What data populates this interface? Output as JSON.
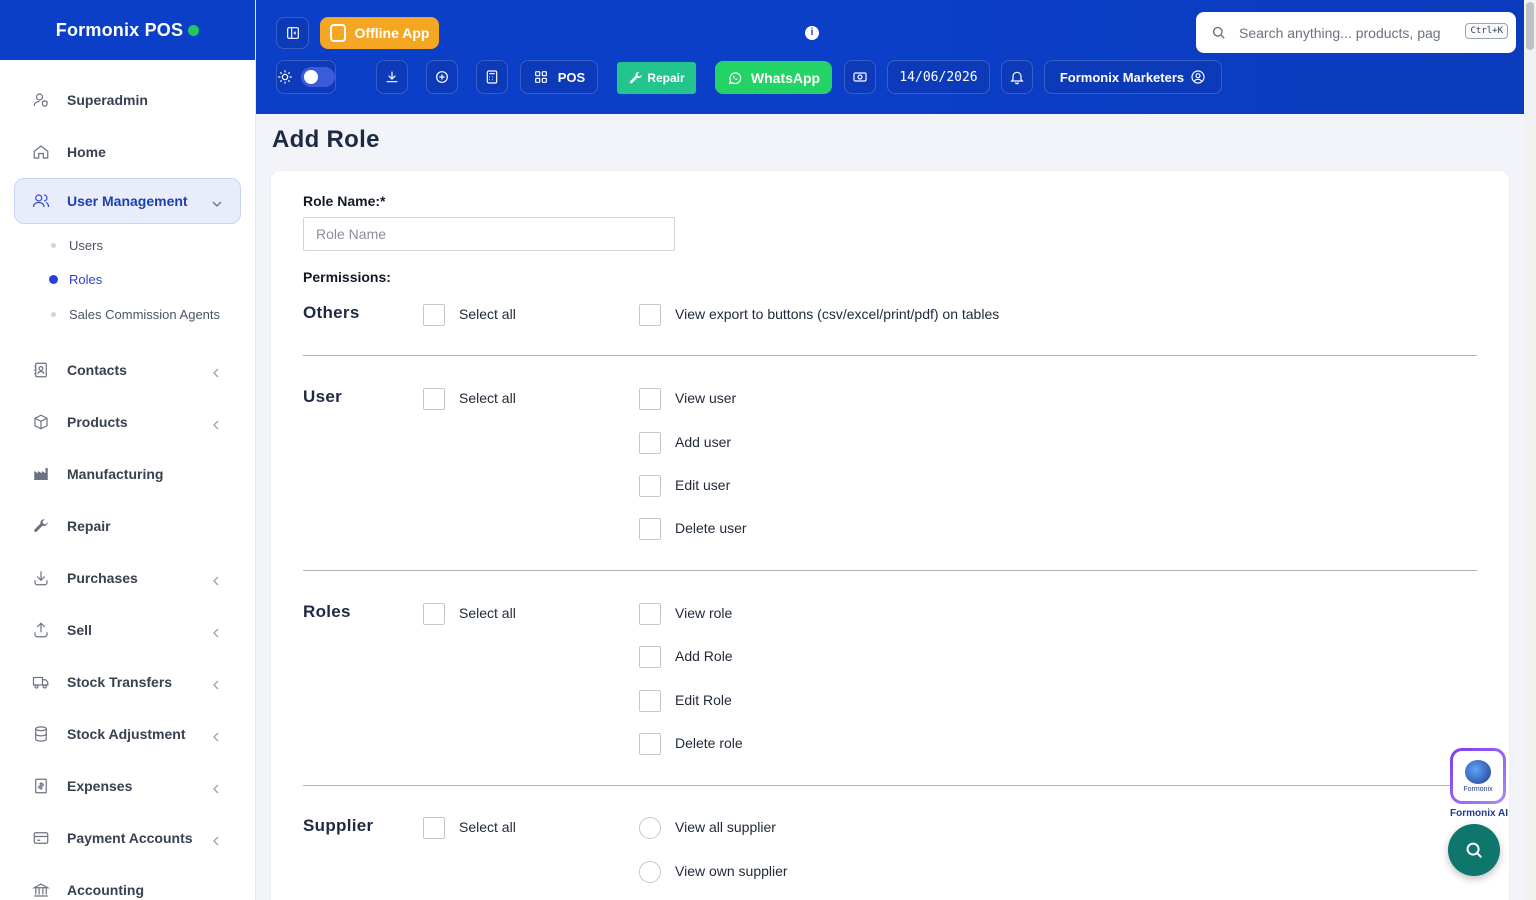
{
  "app": {
    "title": "Formonix POS"
  },
  "sidebar": {
    "items": [
      {
        "label": "Superadmin",
        "icon": "user-shield-icon",
        "chevron": false
      },
      {
        "label": "Home",
        "icon": "home-icon",
        "chevron": false
      },
      {
        "label": "User Management",
        "icon": "users-icon",
        "active": true,
        "expanded": true,
        "subitems": [
          {
            "label": "Users"
          },
          {
            "label": "Roles",
            "active": true
          },
          {
            "label": "Sales Commission Agents"
          }
        ]
      },
      {
        "label": "Contacts",
        "icon": "address-book-icon",
        "chevron": true
      },
      {
        "label": "Products",
        "icon": "box-icon",
        "chevron": true
      },
      {
        "label": "Manufacturing",
        "icon": "factory-icon",
        "chevron": false
      },
      {
        "label": "Repair",
        "icon": "wrench-icon",
        "chevron": false
      },
      {
        "label": "Purchases",
        "icon": "download-icon",
        "chevron": true
      },
      {
        "label": "Sell",
        "icon": "upload-icon",
        "chevron": true
      },
      {
        "label": "Stock Transfers",
        "icon": "truck-icon",
        "chevron": true
      },
      {
        "label": "Stock Adjustment",
        "icon": "database-icon",
        "chevron": true
      },
      {
        "label": "Expenses",
        "icon": "receipt-icon",
        "chevron": true
      },
      {
        "label": "Payment Accounts",
        "icon": "credit-card-icon",
        "chevron": true
      },
      {
        "label": "Accounting",
        "icon": "bank-icon",
        "chevron": false
      }
    ]
  },
  "header": {
    "offline_label": "Offline App",
    "pos_label": "POS",
    "repair_label": "Repair",
    "whatsapp_label": "WhatsApp",
    "date": "14/06/2026",
    "business_label": "Formonix Marketers",
    "search_placeholder": "Search anything... products, pag",
    "search_shortcut": "Ctrl+K",
    "info_glyph": "i"
  },
  "form": {
    "title": "Add Role",
    "role_name_label": "Role Name:*",
    "role_name_placeholder": "Role Name",
    "role_name_value": "",
    "permissions_label": "Permissions:",
    "select_all_label": "Select all",
    "groups": [
      {
        "name": "Others",
        "options": [
          "View export to buttons (csv/excel/print/pdf) on tables"
        ],
        "type": "checkbox"
      },
      {
        "name": "User",
        "options": [
          "View user",
          "Add user",
          "Edit user",
          "Delete user"
        ],
        "type": "checkbox"
      },
      {
        "name": "Roles",
        "options": [
          "View role",
          "Add Role",
          "Edit Role",
          "Delete role"
        ],
        "type": "checkbox"
      },
      {
        "name": "Supplier",
        "options": [
          "View all supplier",
          "View own supplier"
        ],
        "type": "radio"
      }
    ]
  },
  "floating": {
    "ai_label": "Formonix AI",
    "ai_mini_text": "Formonix"
  },
  "colors": {
    "brand": "#0b3fc7",
    "offline": "#f5a623",
    "whatsapp": "#24d366",
    "repair": "#22c58b",
    "fab": "#0f766e",
    "active_nav": "#2b3fd6"
  }
}
